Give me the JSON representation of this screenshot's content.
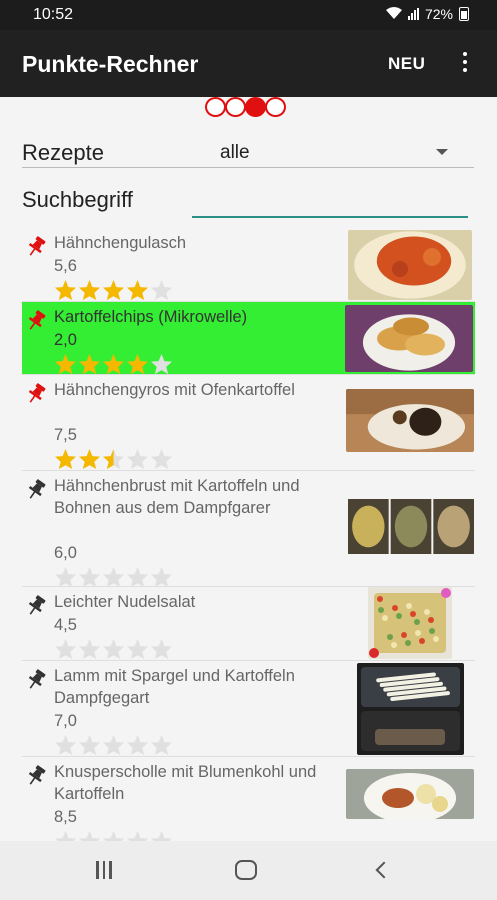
{
  "status_bar": {
    "time": "10:52",
    "battery": "72%"
  },
  "app_bar": {
    "title": "Punkte-Rechner",
    "new_label": "NEU"
  },
  "pager": {
    "pages": 4,
    "active": 2
  },
  "filter": {
    "label": "Rezepte",
    "value": "alle"
  },
  "search": {
    "label": "Suchbegriff",
    "value": "",
    "placeholder": ""
  },
  "recipes": [
    {
      "name": "Hähnchengulasch",
      "points": "5,6",
      "rating": 4,
      "pinned": true,
      "selected": false
    },
    {
      "name": "Kartoffelchips (Mikrowelle)",
      "points": "2,0",
      "rating": 4,
      "pinned": true,
      "selected": true
    },
    {
      "name": "Hähnchengyros mit Ofenkartoffel",
      "points": "7,5",
      "rating": 2.5,
      "pinned": true,
      "selected": false
    },
    {
      "name": "Hähnchenbrust mit Kartoffeln und Bohnen aus dem Dampfgarer",
      "points": "6,0",
      "rating": 0,
      "pinned": false,
      "selected": false
    },
    {
      "name": "Leichter Nudelsalat",
      "points": "4,5",
      "rating": 0,
      "pinned": false,
      "selected": false
    },
    {
      "name": "Lamm mit Spargel und Kartoffeln Dampfgegart",
      "points": "7,0",
      "rating": 0,
      "pinned": false,
      "selected": false
    },
    {
      "name": "Knusperscholle mit Blumenkohl und Kartoffeln",
      "points": "8,5",
      "rating": 0,
      "pinned": false,
      "selected": false
    }
  ],
  "colors": {
    "accent": "#2a8f84",
    "pin_active": "#e01010",
    "pin_inactive": "#333333",
    "star_filled": "#f5b800",
    "star_empty": "#e0e0e0",
    "selected_row": "#33ee33",
    "pager": "#e01010"
  }
}
